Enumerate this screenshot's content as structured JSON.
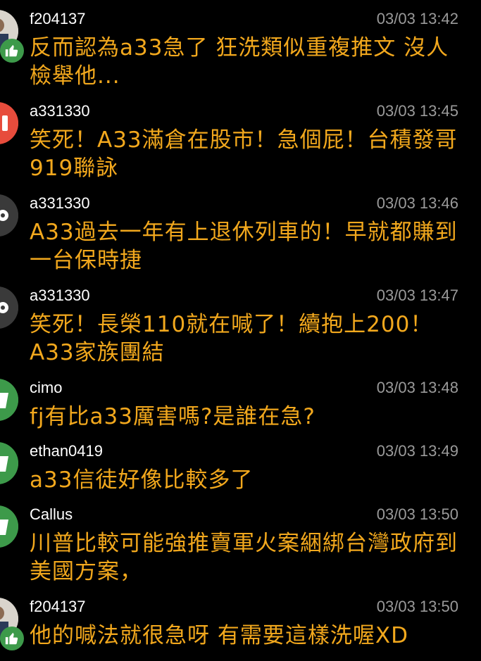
{
  "comments": [
    {
      "username": "f204137",
      "time": "03/03 13:42",
      "text": "反而認為a33急了 狂洗類似重複推文 沒人檢舉他...",
      "avatar": "photo-avatar",
      "badge": "thumbs-up-icon"
    },
    {
      "username": "a331330",
      "time": "03/03 13:45",
      "text": "笑死！A33滿倉在股市！急個屁！台積發哥919聯詠",
      "avatar": "red-avatar"
    },
    {
      "username": "a331330",
      "time": "03/03 13:46",
      "text": "A33過去一年有上退休列車的！早就都賺到一台保時捷",
      "avatar": "dark-avatar"
    },
    {
      "username": "a331330",
      "time": "03/03 13:47",
      "text": "笑死！長榮110就在喊了！續抱上200！A33家族團結",
      "avatar": "dark-avatar"
    },
    {
      "username": "cimo",
      "time": "03/03 13:48",
      "text": "fj有比a33厲害嗎?是誰在急?",
      "avatar": "green-avatar"
    },
    {
      "username": "ethan0419",
      "time": "03/03 13:49",
      "text": "a33信徒好像比較多了",
      "avatar": "green-avatar"
    },
    {
      "username": "Callus",
      "time": "03/03 13:50",
      "text": "川普比較可能強推賣軍火案綑綁台灣政府到美國方案，",
      "avatar": "green-avatar"
    },
    {
      "username": "f204137",
      "time": "03/03 13:50",
      "text": "他的喊法就很急呀 有需要這樣洗喔XD",
      "avatar": "photo-avatar",
      "badge": "thumbs-up-icon"
    }
  ],
  "colors": {
    "background": "#000000",
    "username": "#ffffff",
    "time": "#9a9a9a",
    "text": "#f2a81d",
    "green": "#3d9a4a",
    "red": "#e74c3c",
    "dark": "#3a3a3a"
  }
}
